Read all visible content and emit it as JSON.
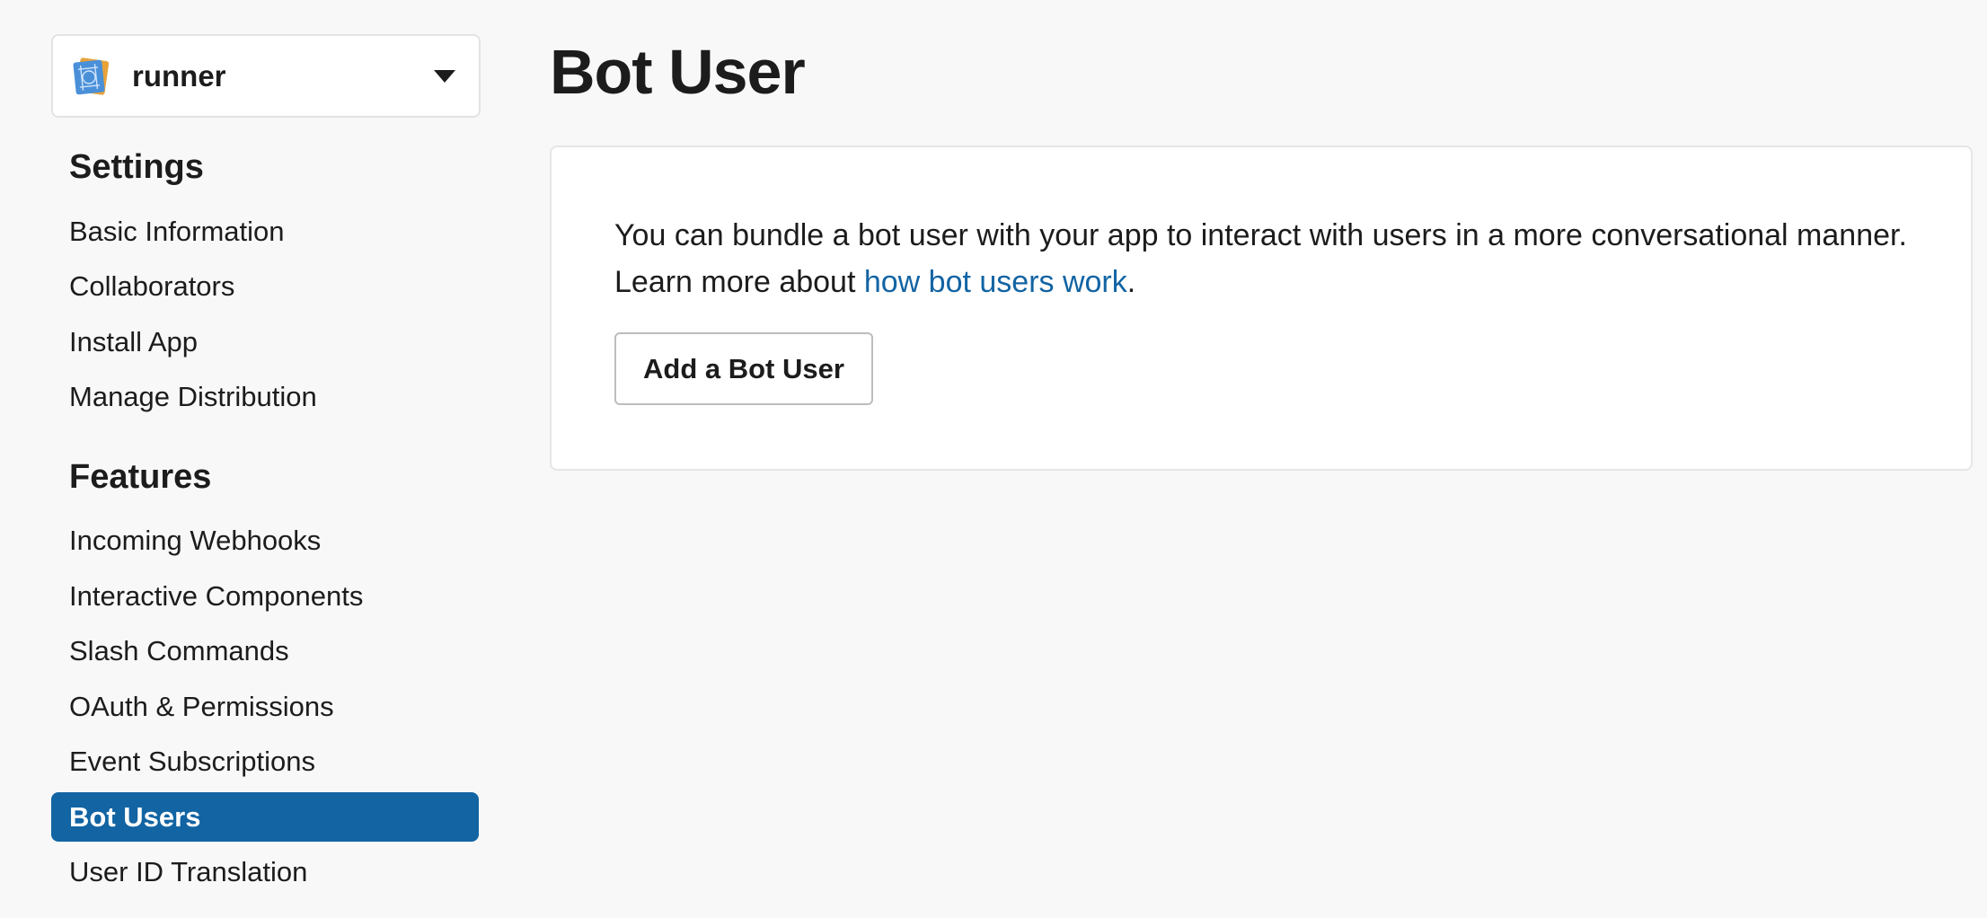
{
  "app": {
    "name": "runner",
    "icon": "blueprint-app-icon"
  },
  "sidebar": {
    "settings_heading": "Settings",
    "settings_items": [
      {
        "label": "Basic Information"
      },
      {
        "label": "Collaborators"
      },
      {
        "label": "Install App"
      },
      {
        "label": "Manage Distribution"
      }
    ],
    "features_heading": "Features",
    "features_items": [
      {
        "label": "Incoming Webhooks"
      },
      {
        "label": "Interactive Components"
      },
      {
        "label": "Slash Commands"
      },
      {
        "label": "OAuth & Permissions"
      },
      {
        "label": "Event Subscriptions"
      },
      {
        "label": "Bot Users",
        "active": true
      },
      {
        "label": "User ID Translation"
      }
    ],
    "active_color": "#1264a3"
  },
  "main": {
    "title": "Bot User",
    "description_prefix": "You can bundle a bot user with your app to interact with users in a more conversational manner. Learn more about ",
    "description_link": "how bot users work",
    "description_suffix": ".",
    "add_button_label": "Add a Bot User",
    "link_color": "#1264a3"
  }
}
